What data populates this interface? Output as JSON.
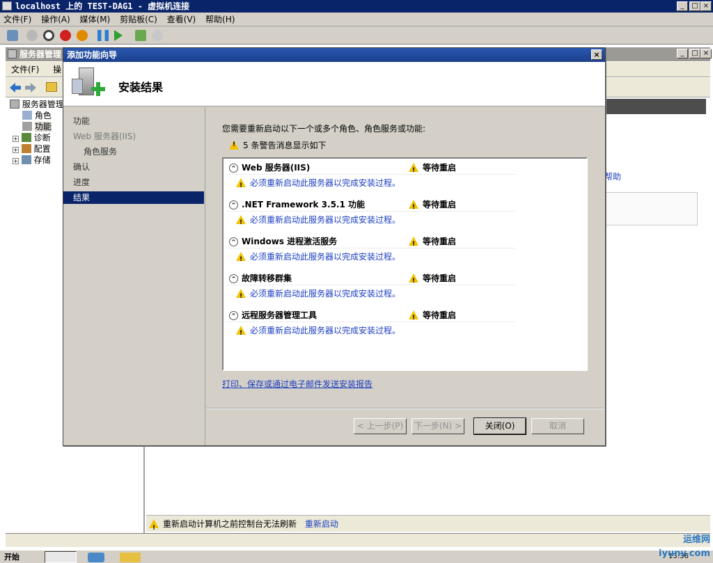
{
  "vm": {
    "title": "localhost 上的 TEST-DAG1 - 虚拟机连接",
    "menu": [
      "文件(F)",
      "操作(A)",
      "媒体(M)",
      "剪贴板(C)",
      "查看(V)",
      "帮助(H)"
    ],
    "window_buttons": [
      "_",
      "□",
      "×"
    ]
  },
  "server_manager": {
    "title": "服务器管理",
    "menu": [
      "文件(F)",
      "操"
    ],
    "tree": [
      {
        "label": "服务器管理",
        "indent": 0
      },
      {
        "label": "角色",
        "indent": 1
      },
      {
        "label": "功能",
        "indent": 1
      },
      {
        "label": "诊断",
        "indent": 1
      },
      {
        "label": "配置",
        "indent": 1
      },
      {
        "label": "存储",
        "indent": 1
      }
    ],
    "right_link": "帮助",
    "status_text": "重新启动计算机之前控制台无法刷新",
    "status_link": "重新启动"
  },
  "wizard": {
    "title": "添加功能向导",
    "close_label": "×",
    "heading": "安装结果",
    "nav": [
      {
        "label": "功能",
        "state": "normal"
      },
      {
        "label": "Web 服务器(IIS)",
        "state": "dim"
      },
      {
        "label": "角色服务",
        "state": "sub"
      },
      {
        "label": "确认",
        "state": "normal"
      },
      {
        "label": "进度",
        "state": "normal"
      },
      {
        "label": "结果",
        "state": "selected"
      }
    ],
    "intro": "您需要重新启动以下一个或多个角色、角色服务或功能:",
    "warning_count": "5 条警告消息显示如下",
    "results": [
      {
        "name": "Web 服务器(IIS)",
        "status": "等待重启",
        "message": "必须重新启动此服务器以完成安装过程。"
      },
      {
        "name": ".NET Framework 3.5.1 功能",
        "status": "等待重启",
        "message": "必须重新启动此服务器以完成安装过程。"
      },
      {
        "name": "Windows 进程激活服务",
        "status": "等待重启",
        "message": "必须重新启动此服务器以完成安装过程。"
      },
      {
        "name": "故障转移群集",
        "status": "等待重启",
        "message": "必须重新启动此服务器以完成安装过程。"
      },
      {
        "name": "远程服务器管理工具",
        "status": "等待重启",
        "message": "必须重新启动此服务器以完成安装过程。"
      }
    ],
    "report_link": "打印、保存或通过电子邮件发送安装报告",
    "buttons": {
      "prev": "< 上一步(P)",
      "next": "下一步(N) >",
      "close": "关闭(O)",
      "cancel": "取消"
    }
  },
  "taskbar": {
    "start": "开始",
    "clock": "13:36"
  },
  "watermark": "运维网 iyunv.com"
}
